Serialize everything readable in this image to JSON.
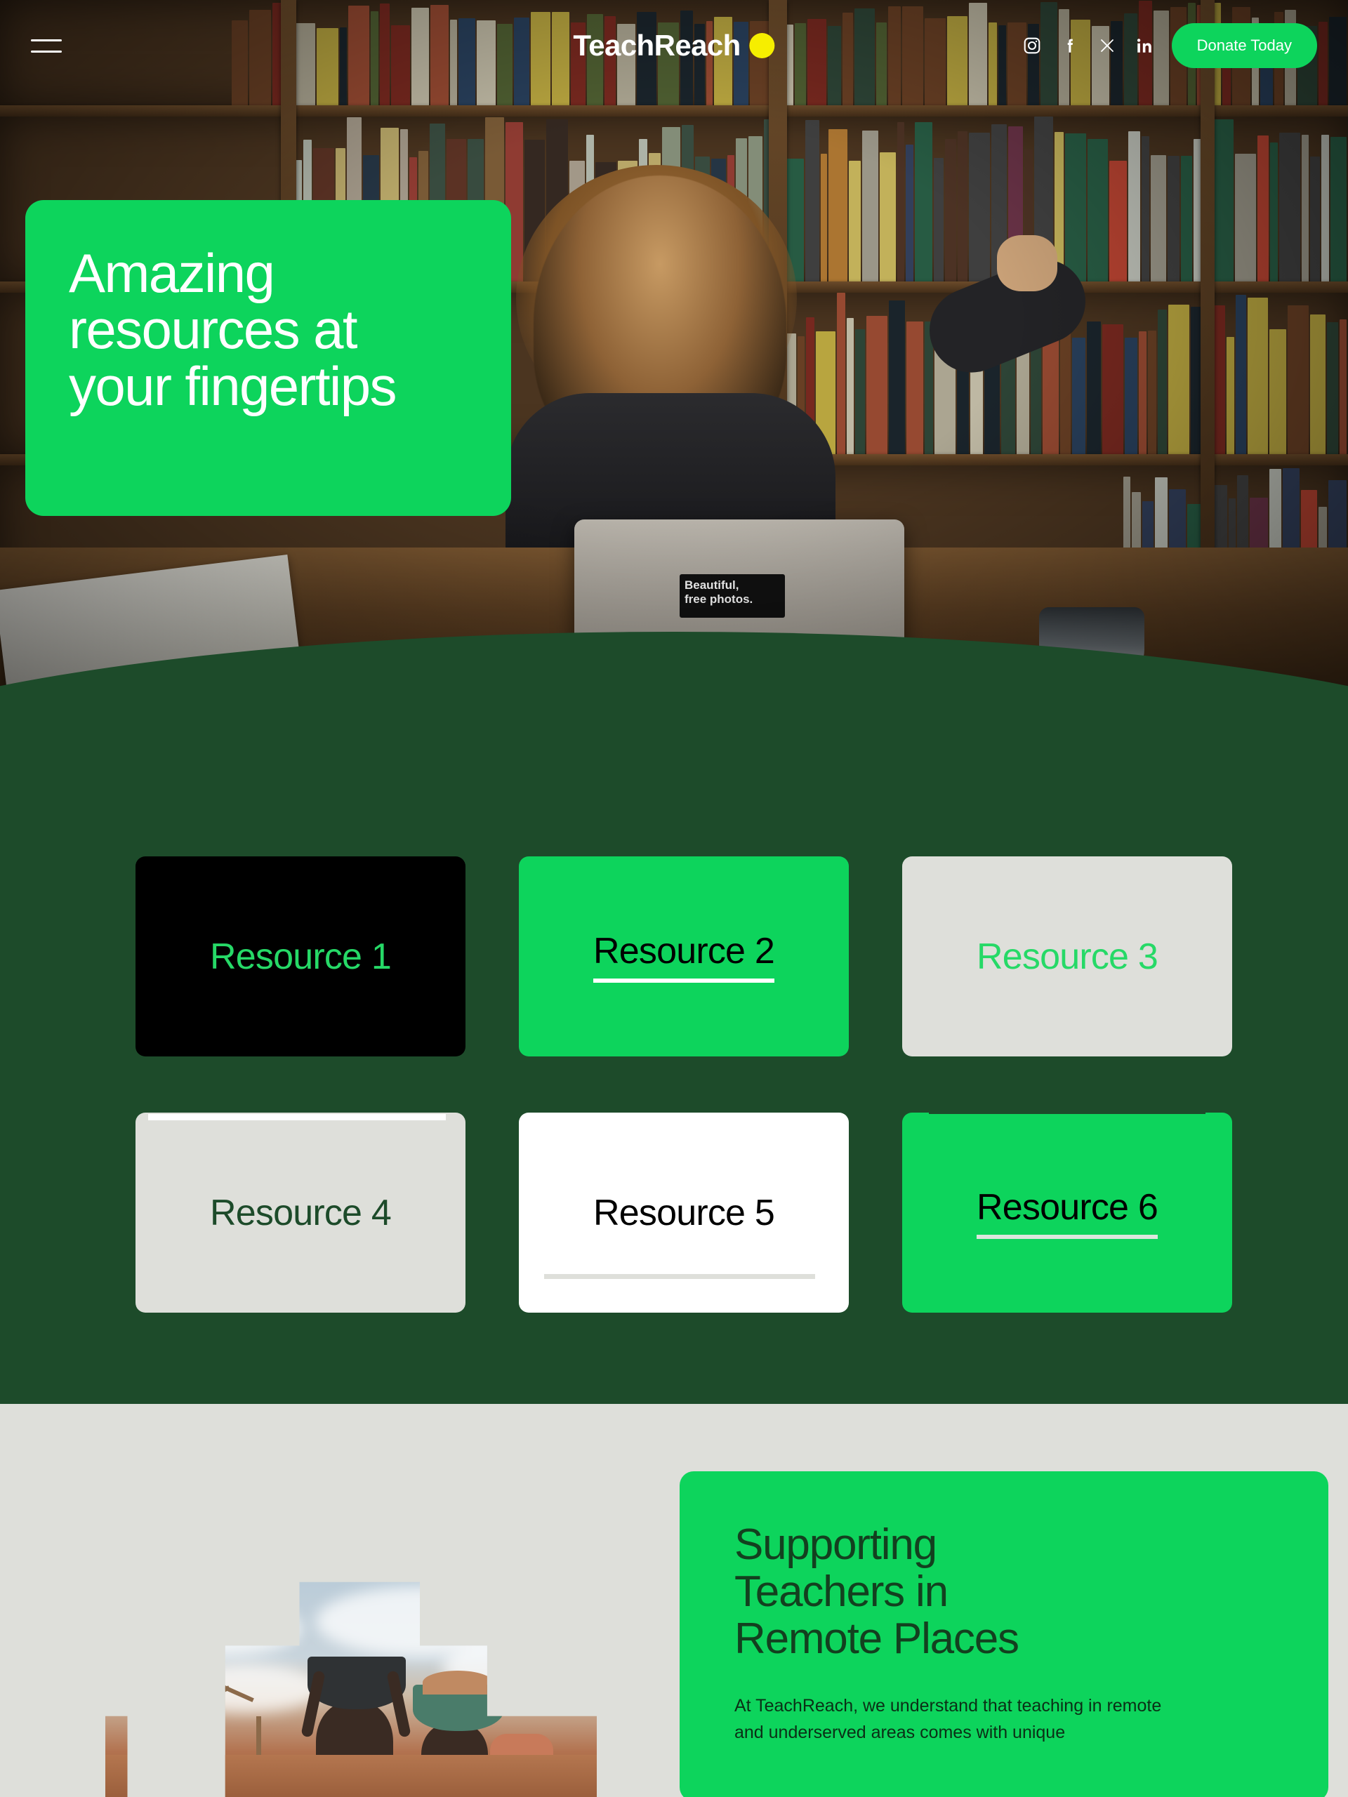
{
  "colors": {
    "bright_green": "#0DD45C",
    "dark_green": "#1D4B2A",
    "light_gray": "#DEDFDA",
    "accent_yellow": "#F6EE00",
    "black": "#000000",
    "white": "#FFFFFF"
  },
  "header": {
    "menu_icon": "hamburger-menu-icon",
    "brand_name": "TeachReach",
    "brand_dot": "yellow-circle-icon",
    "socials": [
      {
        "name": "instagram-icon",
        "label": "Instagram"
      },
      {
        "name": "facebook-icon",
        "label": "Facebook"
      },
      {
        "name": "x-twitter-icon",
        "label": "X"
      },
      {
        "name": "linkedin-icon",
        "label": "LinkedIn"
      }
    ],
    "donate_label": "Donate Today"
  },
  "hero": {
    "headline": "Amazing resources at your fingertips",
    "headline_lines": [
      "Amazing",
      "resources at",
      "your fingertips"
    ]
  },
  "resources": {
    "cards": [
      {
        "label": "Resource 1",
        "style": "black-green"
      },
      {
        "label": "Resource 2",
        "style": "green-black-underline"
      },
      {
        "label": "Resource 3",
        "style": "gray-green"
      },
      {
        "label": "Resource 4",
        "style": "gray-darkgreen-topbar"
      },
      {
        "label": "Resource 5",
        "style": "white-black-bottombar"
      },
      {
        "label": "Resource 6",
        "style": "green-black-underline-topbar"
      }
    ]
  },
  "support": {
    "heading": "Supporting Teachers in Remote Places",
    "heading_lines": [
      "Supporting",
      "Teachers in",
      "Remote Places"
    ],
    "body": "At TeachReach, we understand that teaching in remote and underserved areas comes with unique",
    "image_alt": "people-carrying-basins-photo-collage"
  }
}
